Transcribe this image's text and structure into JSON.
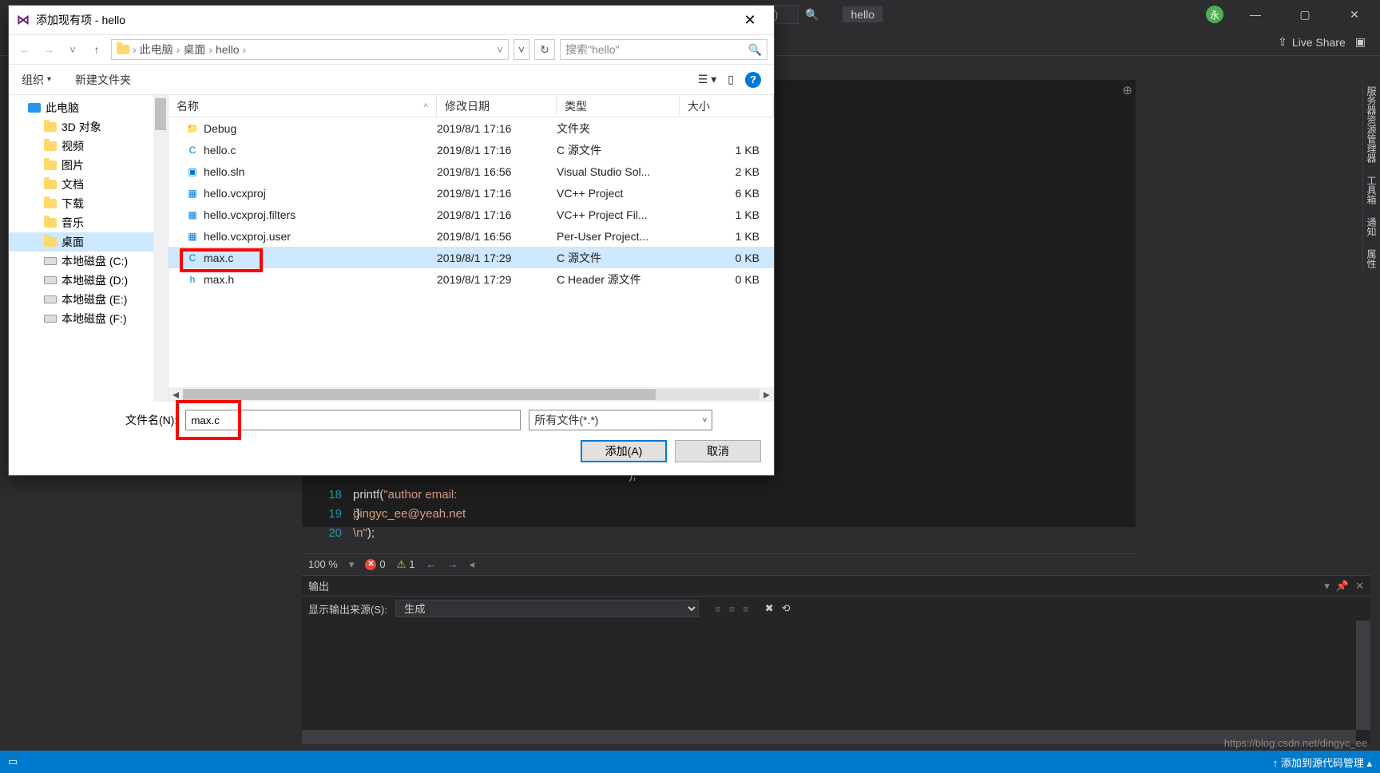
{
  "vs": {
    "search_placeholder": "搜索 Visual Studio (Ctrl+Q)",
    "project": "hello",
    "avatar": "永",
    "live_share": "Live Share",
    "zoom": "100 %",
    "errors": "0",
    "warnings": "1",
    "output_title": "输出",
    "output_src_label": "显示输出来源(S):",
    "output_src_value": "生成",
    "statusbar_right": "添加到源代码管理",
    "watermark": "https://blog.csdn.net/dingyc_ee",
    "rside_tabs": [
      "服务器资源管理器",
      "工具箱",
      "通知",
      "属性"
    ]
  },
  "code": {
    "lines": [
      {
        "n": "",
        "t": ""
      },
      {
        "n": "",
        "t": "   \");"
      },
      {
        "n": "18",
        "t": "printf(\"author email: dingyc_ee@yeah.net  \\n\");"
      },
      {
        "n": "19",
        "t": "}"
      },
      {
        "n": "20",
        "t": ""
      }
    ]
  },
  "dialog": {
    "title": "添加现有项 - hello",
    "breadcrumb": [
      "此电脑",
      "桌面",
      "hello"
    ],
    "search_placeholder": "搜索\"hello\"",
    "organize": "组织",
    "new_folder": "新建文件夹",
    "tree": [
      {
        "label": "此电脑",
        "type": "pc"
      },
      {
        "label": "3D 对象",
        "type": "folder",
        "sub": true
      },
      {
        "label": "视频",
        "type": "folder",
        "sub": true
      },
      {
        "label": "图片",
        "type": "folder",
        "sub": true
      },
      {
        "label": "文档",
        "type": "folder",
        "sub": true
      },
      {
        "label": "下载",
        "type": "folder",
        "sub": true
      },
      {
        "label": "音乐",
        "type": "folder",
        "sub": true
      },
      {
        "label": "桌面",
        "type": "folder",
        "sub": true,
        "selected": true
      },
      {
        "label": "本地磁盘 (C:)",
        "type": "disk",
        "sub": true
      },
      {
        "label": "本地磁盘 (D:)",
        "type": "disk",
        "sub": true
      },
      {
        "label": "本地磁盘 (E:)",
        "type": "disk",
        "sub": true
      },
      {
        "label": "本地磁盘 (F:)",
        "type": "disk",
        "sub": true
      }
    ],
    "columns": {
      "name": "名称",
      "date": "修改日期",
      "type": "类型",
      "size": "大小"
    },
    "files": [
      {
        "name": "Debug",
        "date": "2019/8/1 17:16",
        "type": "文件夹",
        "size": "",
        "icon": "folder"
      },
      {
        "name": "hello.c",
        "date": "2019/8/1 17:16",
        "type": "C 源文件",
        "size": "1 KB",
        "icon": "c"
      },
      {
        "name": "hello.sln",
        "date": "2019/8/1 16:56",
        "type": "Visual Studio Sol...",
        "size": "2 KB",
        "icon": "sln"
      },
      {
        "name": "hello.vcxproj",
        "date": "2019/8/1 17:16",
        "type": "VC++ Project",
        "size": "6 KB",
        "icon": "proj"
      },
      {
        "name": "hello.vcxproj.filters",
        "date": "2019/8/1 17:16",
        "type": "VC++ Project Fil...",
        "size": "1 KB",
        "icon": "proj"
      },
      {
        "name": "hello.vcxproj.user",
        "date": "2019/8/1 16:56",
        "type": "Per-User Project...",
        "size": "1 KB",
        "icon": "proj"
      },
      {
        "name": "max.c",
        "date": "2019/8/1 17:29",
        "type": "C 源文件",
        "size": "0 KB",
        "icon": "c",
        "selected": true
      },
      {
        "name": "max.h",
        "date": "2019/8/1 17:29",
        "type": "C Header 源文件",
        "size": "0 KB",
        "icon": "h"
      }
    ],
    "filename_label": "文件名(N):",
    "filename_value": "max.c",
    "filetype_value": "所有文件(*.*)",
    "add_btn": "添加(A)",
    "cancel_btn": "取消"
  }
}
